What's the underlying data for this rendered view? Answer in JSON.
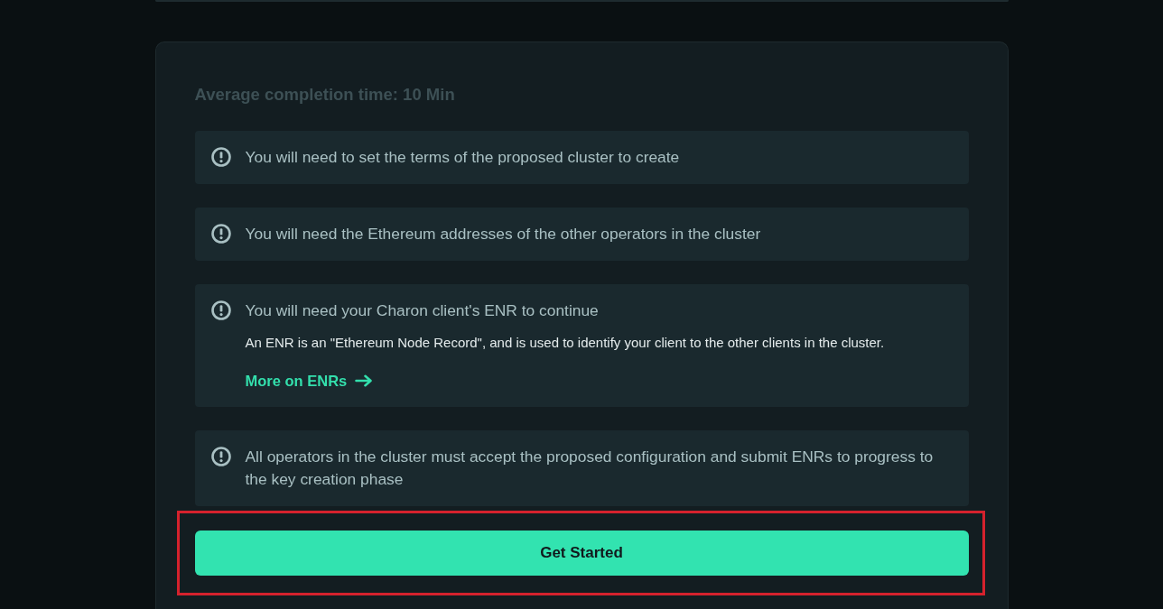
{
  "card": {
    "subtitle": "Average completion time: 10 Min",
    "notices": [
      {
        "text": "You will need to set the terms of the proposed cluster to create"
      },
      {
        "text": "You will need the Ethereum addresses of the other operators in the cluster"
      },
      {
        "text": "You will need your Charon client's ENR to continue",
        "details": "An ENR is an \"Ethereum Node Record\", and is used to identify your client to the other clients in the cluster.",
        "link": "More on ENRs"
      },
      {
        "text": "All operators in the cluster must accept the proposed configuration and submit ENRs to progress to the key creation phase"
      }
    ],
    "button": {
      "label": "Get Started",
      "highlighted": true
    }
  }
}
